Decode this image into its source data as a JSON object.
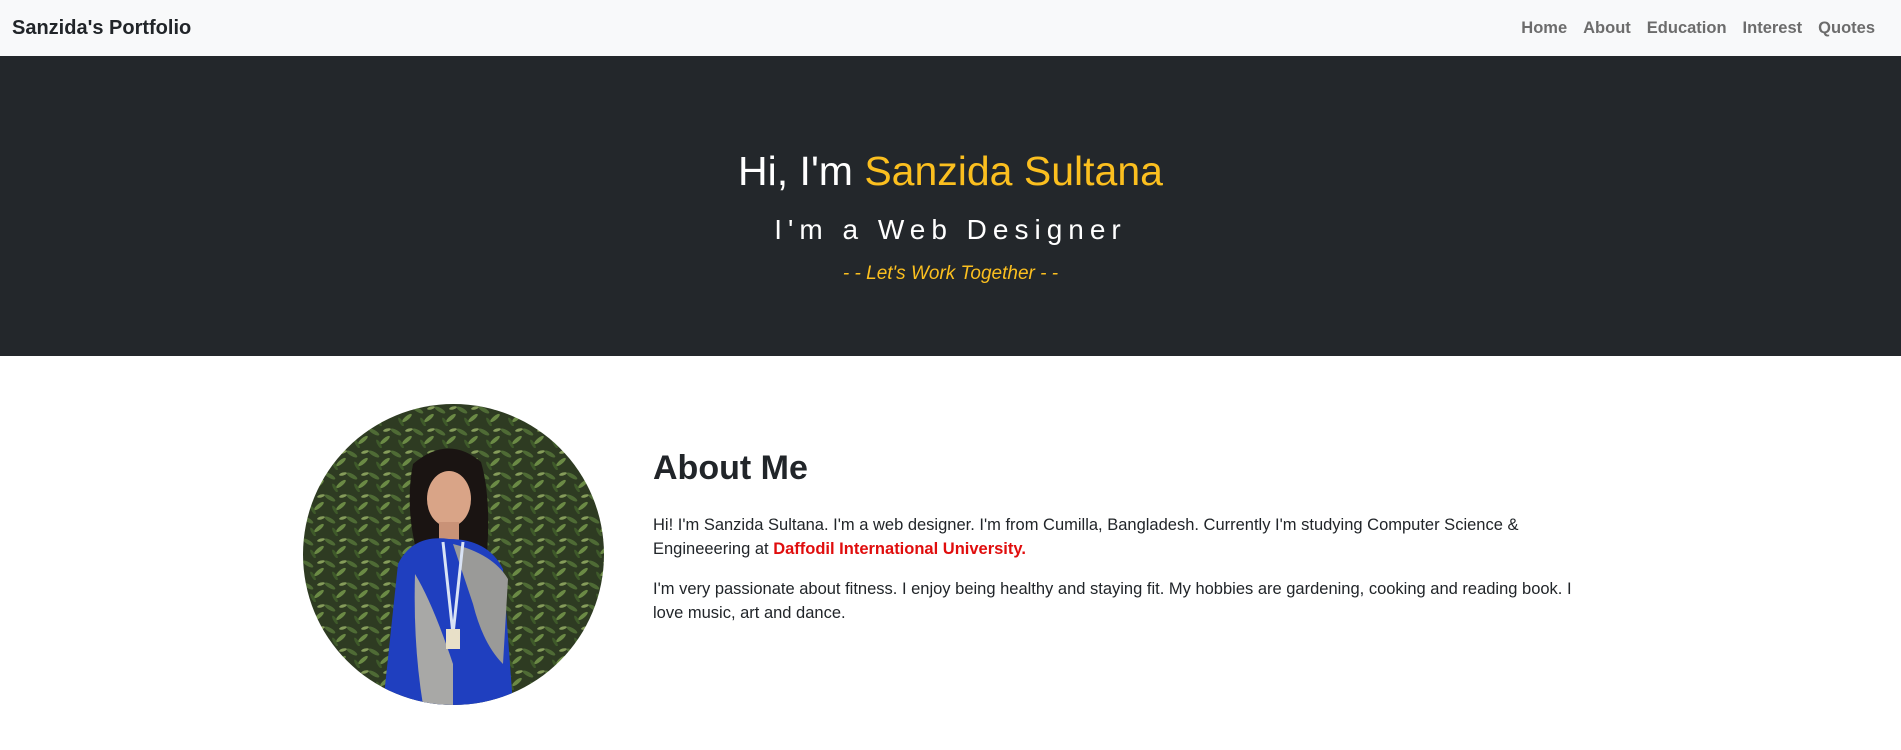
{
  "navbar": {
    "brand": "Sanzida's Portfolio",
    "links": [
      "Home",
      "About",
      "Education",
      "Interest",
      "Quotes"
    ]
  },
  "hero": {
    "greeting": "Hi, I'm ",
    "name": "Sanzida Sultana",
    "subtitle": "I'm a Web Designer",
    "cta": "- - Let's Work Together - -"
  },
  "about": {
    "title": "About Me",
    "para1_pre": "Hi! I'm Sanzida Sultana. I'm a web designer. I'm from Cumilla, Bangladesh. Currently I'm studying Computer Science & Engineeering at ",
    "university": "Daffodil International University.",
    "para2": "I'm very passionate about fitness. I enjoy being healthy and staying fit. My hobbies are gardening, cooking and reading book. I love music, art and dance.",
    "photo_alt": "profile-photo"
  },
  "colors": {
    "accent": "#fbbf1f",
    "hero_bg": "#23272b",
    "navbar_bg": "#f8f9fa",
    "highlight": "#e00d0d"
  }
}
